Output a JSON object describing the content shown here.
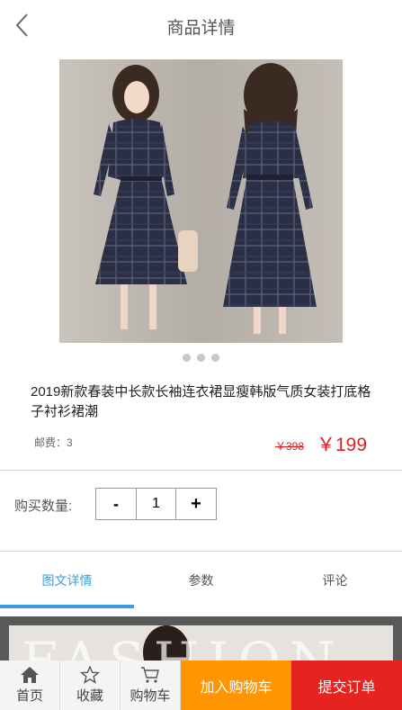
{
  "header": {
    "title": "商品详情",
    "back_icon": "chevron-left-icon"
  },
  "gallery": {
    "slide_count": 3,
    "active_index": 0
  },
  "product": {
    "title": "2019新款春装中长款长袖连衣裙显瘦韩版气质女装打底格子衬衫裙潮",
    "postage": "邮费：3",
    "old_price": "￥398",
    "price": "￥199"
  },
  "quantity": {
    "label": "购买数量:",
    "minus": "-",
    "value": "1",
    "plus": "+"
  },
  "tabs": [
    {
      "label": "图文详情",
      "active": true
    },
    {
      "label": "参数",
      "active": false
    },
    {
      "label": "评论",
      "active": false
    }
  ],
  "detail_banner": {
    "text": "FASHION"
  },
  "bottom_nav": [
    {
      "label": "首页",
      "icon": "home-icon"
    },
    {
      "label": "收藏",
      "icon": "star-icon"
    },
    {
      "label": "购物车",
      "icon": "cart-icon"
    }
  ],
  "actions": {
    "add_to_cart": "加入购物车",
    "submit_order": "提交订单"
  },
  "colors": {
    "accent": "#3a9fdc",
    "price": "#e02020",
    "cart": "#ff9500",
    "order": "#e52420"
  }
}
